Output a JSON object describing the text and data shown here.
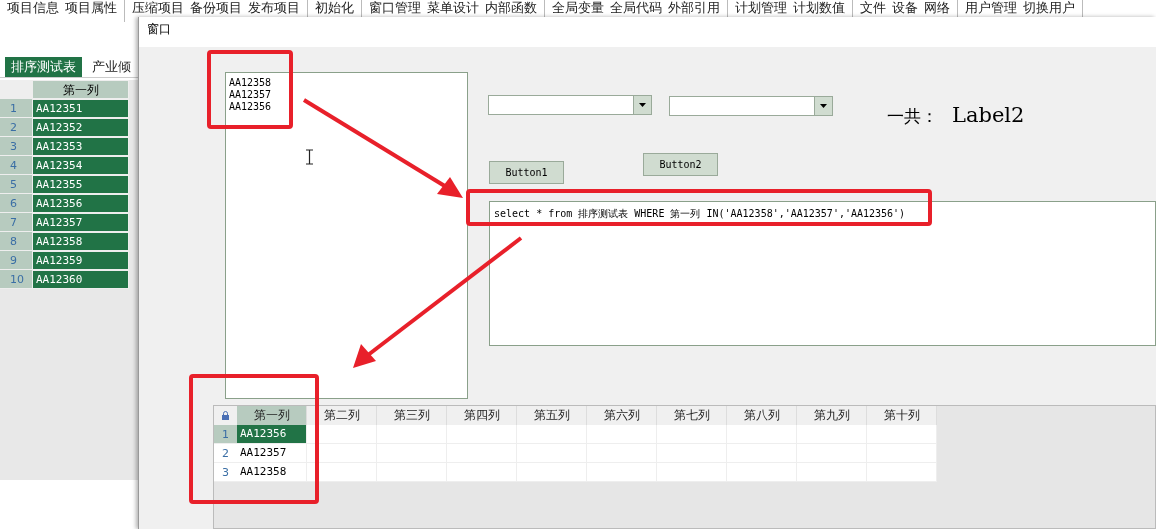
{
  "toolbar": {
    "groups": [
      [
        "项目信息",
        "项目属性"
      ],
      [
        "压缩项目",
        "备份项目",
        "发布项目"
      ],
      [
        "初始化"
      ],
      [
        "窗口管理",
        "菜单设计",
        "内部函数"
      ],
      [
        "全局变量",
        "全局代码",
        "外部引用"
      ],
      [
        "计划管理",
        "计划数值"
      ],
      [
        "文件",
        "设备",
        "网络"
      ],
      [
        "用户管理",
        "切换用户"
      ]
    ]
  },
  "sheet_tabs": [
    {
      "label": "排序测试表",
      "selected": true
    },
    {
      "label": "产业倾",
      "selected": false
    }
  ],
  "left_grid": {
    "columns": [
      "第一列"
    ],
    "rows": [
      {
        "num": "1",
        "value": "AA12351",
        "selected": true
      },
      {
        "num": "2",
        "value": "AA12352",
        "selected": true
      },
      {
        "num": "3",
        "value": "AA12353",
        "selected": true
      },
      {
        "num": "4",
        "value": "AA12354",
        "selected": true
      },
      {
        "num": "5",
        "value": "AA12355",
        "selected": true
      },
      {
        "num": "6",
        "value": "AA12356",
        "selected": true
      },
      {
        "num": "7",
        "value": "AA12357",
        "selected": true
      },
      {
        "num": "8",
        "value": "AA12358",
        "selected": true
      },
      {
        "num": "9",
        "value": "AA12359",
        "selected": true
      },
      {
        "num": "10",
        "value": "AA12360",
        "selected": true
      }
    ]
  },
  "window": {
    "title": "窗口",
    "input_box": {
      "lines": [
        "AA12358",
        "AA12357",
        "AA12356"
      ]
    },
    "combos": [
      {
        "kind": "dropdown"
      },
      {
        "kind": "dropdown"
      }
    ],
    "total_label": {
      "caption": "一共：",
      "value": "Label2"
    },
    "buttons": [
      "Button1",
      "Button2"
    ],
    "sql_box": {
      "value": "select * from 排序测试表 WHERE 第一列 IN('AA12358','AA12357','AA12356')"
    },
    "result_grid": {
      "columns": [
        {
          "label": "第一列",
          "selected": true
        },
        {
          "label": "第二列",
          "selected": false
        },
        {
          "label": "第三列",
          "selected": false
        },
        {
          "label": "第四列",
          "selected": false
        },
        {
          "label": "第五列",
          "selected": false
        },
        {
          "label": "第六列",
          "selected": false
        },
        {
          "label": "第七列",
          "selected": false
        },
        {
          "label": "第八列",
          "selected": false
        },
        {
          "label": "第九列",
          "selected": false
        },
        {
          "label": "第十列",
          "selected": false
        }
      ],
      "rows": [
        {
          "num": "1",
          "cells": [
            "AA12356"
          ],
          "selected": true
        },
        {
          "num": "2",
          "cells": [
            "AA12357"
          ],
          "selected": false
        },
        {
          "num": "3",
          "cells": [
            "AA12358"
          ],
          "selected": false
        }
      ]
    }
  }
}
